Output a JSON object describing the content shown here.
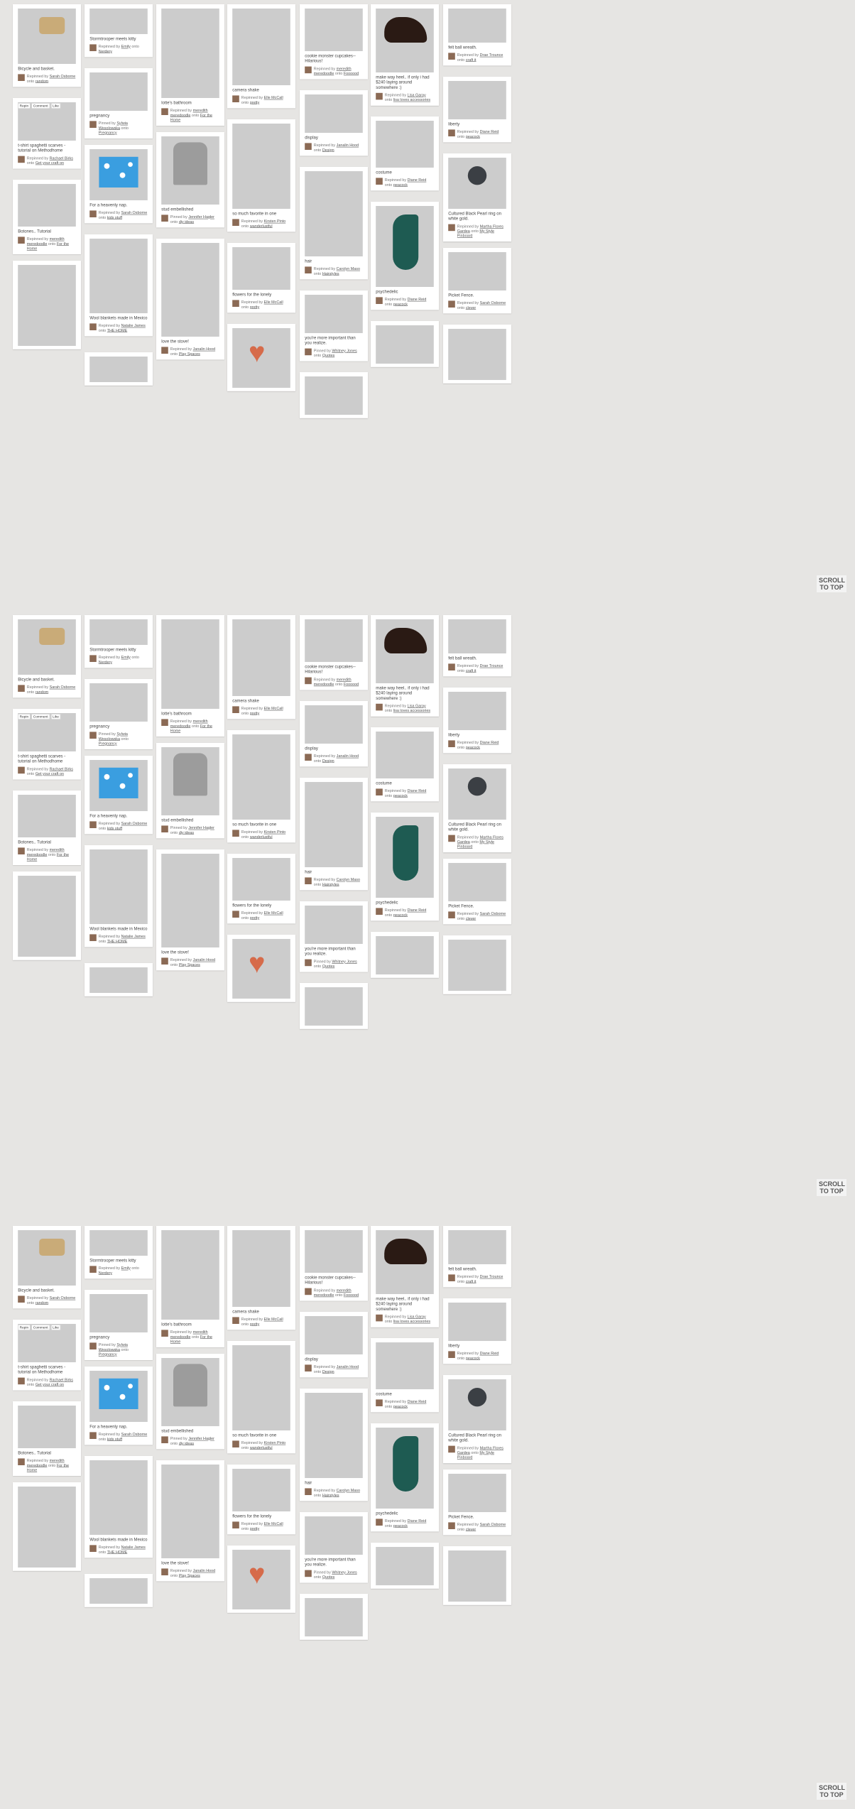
{
  "page": {
    "scroll_to_top_label": "SCROLL TO TOP"
  },
  "pin_actions": {
    "repin": "Repin",
    "comment": "Comment",
    "like": "Like"
  },
  "columns": [
    [
      {
        "visual": "bike",
        "desc": "Bicycle and basket.",
        "verb": "Repinned by",
        "user": "Sarah Osborne",
        "board": "random"
      },
      {
        "visual": "scarf",
        "actions": true,
        "desc": "t-shirt spaghetti scarves - tutorial on Methodhome",
        "verb": "Repinned by",
        "user": "Rachael Birks",
        "board": "Get your craft on"
      },
      {
        "visual": "buttons",
        "desc": "Botones.. Tutorial",
        "verb": "Repinned by",
        "user": "meredith meredoodle",
        "board": "For the Home"
      },
      {
        "visual": "library",
        "desc": "",
        "verb": "",
        "user": "",
        "board": ""
      }
    ],
    [
      {
        "visual": "storm",
        "desc": "Stormtrooper meets kitty",
        "verb": "Repinned by",
        "user": "Emily",
        "board": "Nerdery"
      },
      {
        "visual": "pregnancy",
        "desc": "pregnancy",
        "verb": "Pinned by",
        "user": "Sylwia Wesolowska",
        "board": "Pregnancy"
      },
      {
        "visual": "pillow",
        "desc": "For a heavenly nap.",
        "verb": "Repinned by",
        "user": "Sarah Osborne",
        "board": "kids stuff"
      },
      {
        "visual": "wool",
        "desc": "Wool blankets made in Mexico",
        "verb": "Repinned by",
        "user": "Natalie James",
        "board": "THE HOME"
      },
      {
        "visual": "fire",
        "desc": "",
        "verb": "",
        "user": "",
        "board": ""
      }
    ],
    [
      {
        "visual": "bath",
        "desc": "lotte's bathroom",
        "verb": "Repinned by",
        "user": "meredith meredoodle",
        "board": "For the Home"
      },
      {
        "visual": "sweater",
        "desc": "stud embellished",
        "verb": "Pinned by",
        "user": "Jennifer Hagler",
        "board": "diy ideas"
      },
      {
        "visual": "stove",
        "desc": "love the stove!",
        "verb": "Repinned by",
        "user": "Janalin Hood",
        "board": "Play Spaces"
      }
    ],
    [
      {
        "visual": "cup",
        "desc": "camera shake",
        "verb": "Repinned by",
        "user": "Elle McCall",
        "board": "pretty"
      },
      {
        "visual": "curtain",
        "desc": "so much favorite in one",
        "verb": "Repinned by",
        "user": "Kirsten Pinto",
        "board": "wanderlustful"
      },
      {
        "visual": "flowers",
        "desc": "flowers for the lonely",
        "verb": "Repinned by",
        "user": "Elle McCall",
        "board": "pretty"
      },
      {
        "visual": "heart",
        "desc": "",
        "verb": "",
        "user": "",
        "board": ""
      }
    ],
    [
      {
        "visual": "cookie",
        "desc": "cookie monster cupcakes-- Hilarious!",
        "verb": "Repinned by",
        "user": "meredith meredoodle",
        "board": "Foooood"
      },
      {
        "visual": "display",
        "desc": "display",
        "verb": "Repinned by",
        "user": "Janalin Hood",
        "board": "Design"
      },
      {
        "visual": "hair",
        "desc": "hair",
        "verb": "Repinned by",
        "user": "Carolyn Maso",
        "board": "Hairstyles"
      },
      {
        "visual": "quote",
        "desc": "you're more important than you realize.",
        "verb": "Pinned by",
        "user": "Whitney Jones",
        "board": "Quotes"
      },
      {
        "visual": "whites",
        "desc": "",
        "verb": "",
        "user": "",
        "board": ""
      }
    ],
    [
      {
        "visual": "shoe",
        "desc": "make way heel.. if only i had $240 laying around somewhere :)",
        "verb": "Repinned by",
        "user": "Lisa Garay",
        "board": "lisa loves accessories"
      },
      {
        "visual": "costume",
        "desc": "costume",
        "verb": "Repinned by",
        "user": "Diane Reid",
        "board": "peacock"
      },
      {
        "visual": "peacock",
        "desc": "psychedelic",
        "verb": "Repinned by",
        "user": "Diane Reid",
        "board": "peacock"
      },
      {
        "visual": "chairs",
        "desc": "",
        "verb": "",
        "user": "",
        "board": ""
      }
    ],
    [
      {
        "visual": "wreath",
        "desc": "felt ball wreath.",
        "verb": "Repinned by",
        "user": "Drae Trounce",
        "board": "craft it"
      },
      {
        "visual": "liberty",
        "desc": "liberty",
        "verb": "Repinned by",
        "user": "Diane Reid",
        "board": "peacock"
      },
      {
        "visual": "ring",
        "desc": "Cultured Black Pearl ring on white gold.",
        "verb": "Repinned by",
        "user": "Martha Flores Gardea",
        "board": "My Style Pinboard"
      },
      {
        "visual": "fence",
        "desc": "Picket Fence.",
        "verb": "Repinned by",
        "user": "Sarah Osborne",
        "board": "clever"
      },
      {
        "visual": "bw",
        "desc": "",
        "verb": "",
        "user": "",
        "board": ""
      }
    ]
  ]
}
